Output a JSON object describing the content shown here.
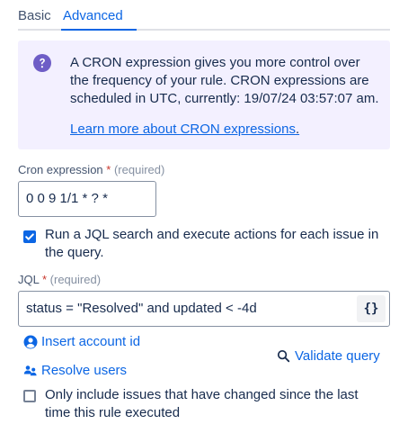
{
  "tabs": [
    {
      "label": "Basic",
      "active": false
    },
    {
      "label": "Advanced",
      "active": true
    }
  ],
  "info": {
    "text": "A CRON expression gives you more control over the frequency of your rule. CRON expressions are scheduled in UTC, currently: 19/07/24 03:57:07 am.",
    "link_label": "Learn more about CRON expressions",
    "link_suffix": ".",
    "icon": "question-circle-icon",
    "icon_color": "#6e5dc6"
  },
  "cron": {
    "label": "Cron expression",
    "required_mark": "*",
    "required_text": "(required)",
    "value": "0 0 9 1/1 * ? *"
  },
  "run_jql": {
    "checked": true,
    "label": "Run a JQL search and execute actions for each issue in the query."
  },
  "jql": {
    "label": "JQL",
    "required_mark": "*",
    "required_text": "(required)",
    "value": "status = \"Resolved\" and updated < -4d",
    "braces_label": "{}"
  },
  "actions": {
    "insert_account_label": "Insert account id",
    "resolve_users_label": "Resolve users",
    "validate_query_label": "Validate query"
  },
  "changed_only": {
    "checked": false,
    "label": "Only include issues that have changed since the last time this rule executed"
  },
  "colors": {
    "accent": "#0c66e4",
    "panel_bg": "#f3f0ff",
    "required": "#c9372c"
  }
}
